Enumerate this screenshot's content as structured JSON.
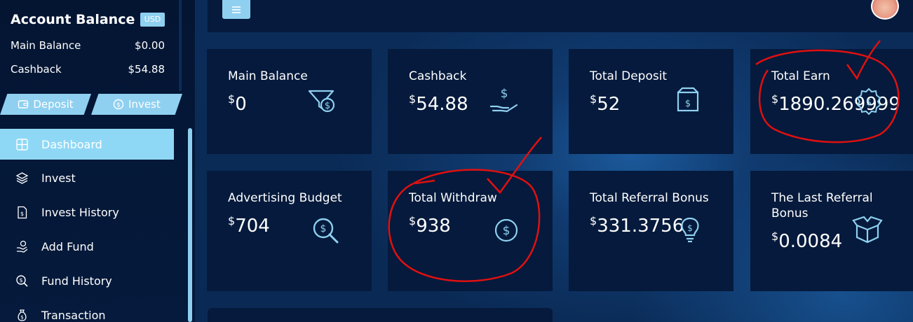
{
  "sidebar": {
    "account_title": "Account Balance",
    "currency_badge": "USD",
    "balances": [
      {
        "label": "Main Balance",
        "value": "$0.00"
      },
      {
        "label": "Cashback",
        "value": "$54.88"
      }
    ],
    "deposit_label": "Deposit",
    "invest_label": "Invest",
    "nav": [
      {
        "label": "Dashboard",
        "icon": "grid-icon",
        "active": true
      },
      {
        "label": "Invest",
        "icon": "layers-icon"
      },
      {
        "label": "Invest History",
        "icon": "document-icon"
      },
      {
        "label": "Add Fund",
        "icon": "hand-coin-icon"
      },
      {
        "label": "Fund History",
        "icon": "search-dollar-icon"
      },
      {
        "label": "Transaction",
        "icon": "money-bag-icon"
      }
    ]
  },
  "topbar": {
    "menu_icon": "hamburger-icon",
    "avatar": "user-avatar"
  },
  "cards": [
    {
      "label": "Main Balance",
      "currency": "$",
      "value": "0",
      "icon": "funnel-dollar-icon"
    },
    {
      "label": "Cashback",
      "currency": "$",
      "value": "54.88",
      "icon": "hand-dollar-icon"
    },
    {
      "label": "Total Deposit",
      "currency": "$",
      "value": "52",
      "icon": "box-dollar-icon"
    },
    {
      "label": "Total Earn",
      "currency": "$",
      "value": "1890.269999",
      "icon": "badge-dollar-icon"
    },
    {
      "label": "Advertising Budget",
      "currency": "$",
      "value": "704",
      "icon": "magnifier-dollar-icon"
    },
    {
      "label": "Total Withdraw",
      "currency": "$",
      "value": "938",
      "icon": "dollar-circle-icon"
    },
    {
      "label": "Total Referral Bonus",
      "currency": "$",
      "value": "331.3756",
      "icon": "bulb-dollar-icon"
    },
    {
      "label": "The Last Referral Bonus",
      "currency": "$",
      "value": "0.0084",
      "icon": "open-box-icon"
    }
  ],
  "colors": {
    "accent": "#8fd0f0",
    "panel": "#051a3c",
    "background": "#0a2a55",
    "annotation": "#e01010"
  }
}
